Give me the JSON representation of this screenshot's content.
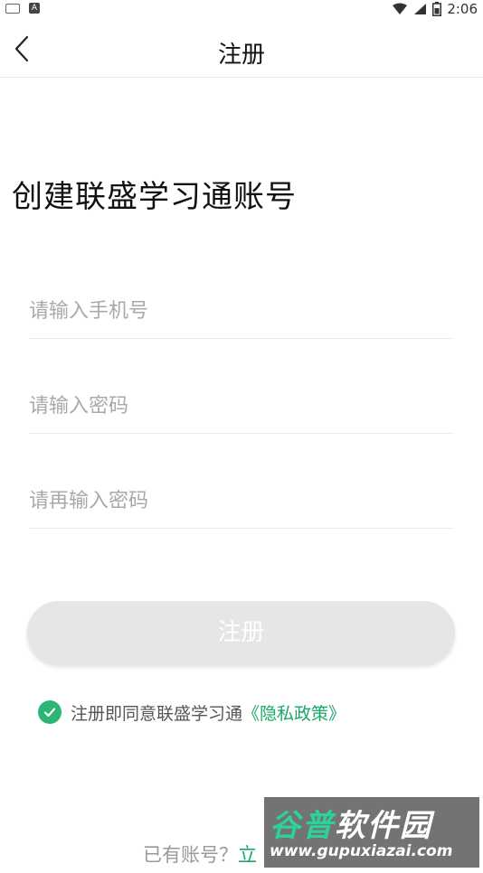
{
  "status_bar": {
    "time": "2:06",
    "left_icons": [
      "keyboard-icon",
      "a-notification-icon"
    ],
    "right_icons": [
      "wifi-icon",
      "signal-icon",
      "battery-icon"
    ],
    "a_label": "A"
  },
  "header": {
    "title": "注册",
    "back_icon": "chevron-left-icon"
  },
  "main": {
    "heading": "创建联盛学习通账号"
  },
  "form": {
    "phone_placeholder": "请输入手机号",
    "password_placeholder": "请输入密码",
    "confirm_password_placeholder": "请再输入密码",
    "register_label": "注册"
  },
  "agreement": {
    "text": "注册即同意联盛学习通",
    "link": "《隐私政策》",
    "checked": true
  },
  "footer": {
    "question": "已有账号？",
    "login_link": "立"
  },
  "watermark": {
    "brand_part1": "谷普",
    "brand_part2": "软件园",
    "url": "www.gupuxiazai.com"
  },
  "colors": {
    "accent_green": "#1aa865",
    "check_green": "#2bb673",
    "button_disabled": "#e6e6e6",
    "placeholder": "#a9a9a9"
  }
}
